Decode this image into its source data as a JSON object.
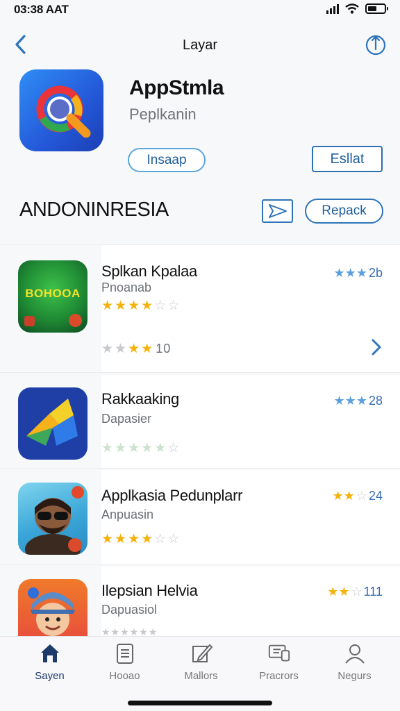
{
  "status": {
    "time": "03:38 AAT"
  },
  "nav": {
    "title": "Layar"
  },
  "hero": {
    "app_name": "AppStmla",
    "developer": "Peplkanin",
    "install_label": "Insaap",
    "get_label": "Esllat"
  },
  "section": {
    "title": "ANDONINRESIA",
    "report_label": "Repack"
  },
  "apps": [
    {
      "name": "Splkan Kpalaa",
      "developer": "Pnoanab",
      "score": "2b",
      "rating_count": "10",
      "icon_text": "BOHOOA"
    },
    {
      "name": "Rakkaaking",
      "developer": "Dapasier",
      "score": "28"
    },
    {
      "name": "Applkasia Pedunplarr",
      "developer": "Anpuasin",
      "score": "24"
    },
    {
      "name": "Ilepsian Helvia",
      "developer": "Dapuasiol",
      "score": "111"
    }
  ],
  "tabs": [
    {
      "label": "Sayen",
      "icon": "home-icon"
    },
    {
      "label": "Hooao",
      "icon": "document-icon"
    },
    {
      "label": "Mallors",
      "icon": "edit-icon"
    },
    {
      "label": "Pracrors",
      "icon": "screen-icon"
    },
    {
      "label": "Negurs",
      "icon": "person-icon"
    }
  ],
  "colors": {
    "accent": "#2d74b8",
    "star": "#f4b20c",
    "active_tab": "#1e3a6b"
  }
}
